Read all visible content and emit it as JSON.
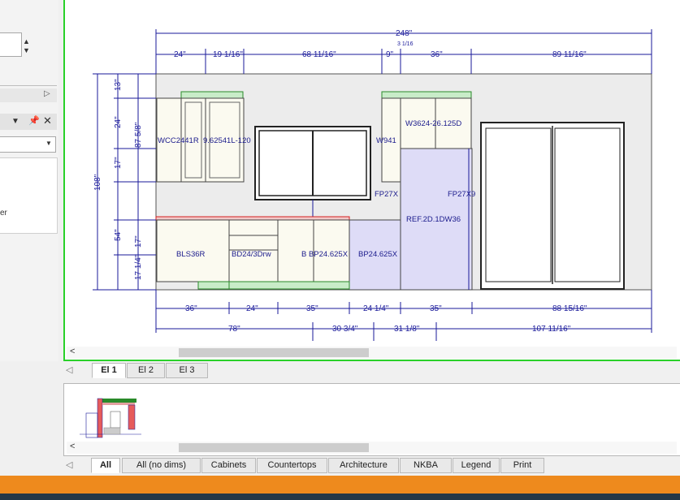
{
  "tabs_elevation": [
    "El 1",
    "El 2",
    "El 3"
  ],
  "tabs_view": [
    "All",
    "All (no dims)",
    "Cabinets",
    "Countertops",
    "Architecture",
    "NKBA",
    "Legend",
    "Print"
  ],
  "left_panel": {
    "partial_text": "er"
  },
  "dimensions": {
    "overall_top": "248\"",
    "top_row": [
      "24\"",
      "19 1/16\"",
      "68 11/16\"",
      "9\"",
      "3 1/16",
      "36\"",
      "89 11/16\""
    ],
    "bottom_row1": [
      "36\"",
      "24\"",
      "35\"",
      "24 1/4\"",
      "35\"",
      "88 15/16\""
    ],
    "bottom_row2": [
      "78\"",
      "30 3/4\"",
      "31 1/8\"",
      "107 11/16\""
    ],
    "left": [
      "108\"",
      "13\"",
      "24\"",
      "17\"",
      "87 5/8\"",
      "54\"",
      "17\"",
      "17 1/4\""
    ]
  },
  "cabinet_labels": {
    "wall_left": "WCC2441R",
    "wall_left2": "9.62541L-120",
    "wall_mid": "W941",
    "wall_right": "W3624-26.125D",
    "filler_left": "FP27X",
    "filler_right": "FP27X9",
    "refrigerator": "REF.2D.1DW36",
    "base_left": "BLS36R",
    "base_drawer": "BD24/3Drw",
    "base_b": "B BP24.625X",
    "base_bp": "BP24.625X"
  },
  "colors": {
    "accent_green": "#2ad12a",
    "dim_blue": "#1a1a9a",
    "countertop_red": "#d42020",
    "ref_fill": "#dedcf7",
    "orange": "#ee8a1d"
  }
}
